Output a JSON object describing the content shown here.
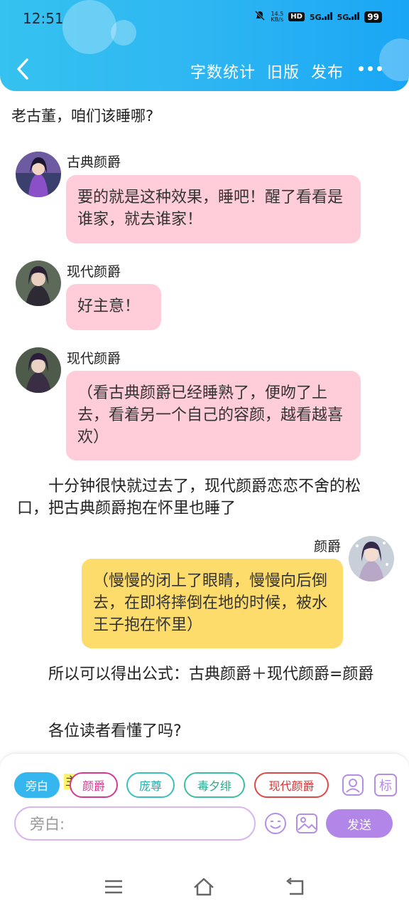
{
  "status_bar": {
    "time": "12:51",
    "net_speed_value": "14.5",
    "net_speed_unit": "KB/s",
    "hd_label": "HD",
    "sim1": "5G",
    "sim2": "5G",
    "battery": "99"
  },
  "header": {
    "word_count": "字数统计",
    "old_version": "旧版",
    "publish": "发布"
  },
  "messages": {
    "narration_1": "老古董，咱们该睡哪?",
    "m1": {
      "speaker": "古典颜爵",
      "text": "要的就是这种效果，睡吧！醒了看看是谁家，就去谁家！"
    },
    "m2": {
      "speaker": "现代颜爵",
      "text": "好主意！"
    },
    "m3": {
      "speaker": "现代颜爵",
      "text": "（看古典颜爵已经睡熟了，便吻了上去，看着另一个自己的容颜，越看越喜欢）"
    },
    "narration_2": "十分钟很快就过去了，现代颜爵恋恋不舍的松口，把古典颜爵抱在怀里也睡了",
    "m4": {
      "speaker": "颜爵",
      "text": "（慢慢的闭上了眼睛，慢慢向后倒去，在即将摔倒在地的时候，被水王子抱在怀里）"
    },
    "narration_3": "所以可以得出公式：古典颜爵＋现代颜爵=颜爵",
    "narration_4": "各位读者看懂了吗?"
  },
  "roles": {
    "narrator": "旁白",
    "host_tag": "主",
    "role_1": "颜爵",
    "role_2": "庞尊",
    "role_3": "毒夕绯",
    "role_4": "现代颜爵",
    "tag_btn": "标"
  },
  "composer": {
    "placeholder": "旁白:",
    "send": "发送"
  },
  "colors": {
    "header_blue": "#2eb6f2",
    "pink_bubble": "#ffcdd9",
    "yellow_bubble": "#fedc6c",
    "send_purple": "#b186e8",
    "narrator_chip": "#35b6ee",
    "role_1": "#d23b8f",
    "role_2": "#3bbfbe",
    "role_3": "#3bbfa0",
    "role_4": "#e04848"
  }
}
